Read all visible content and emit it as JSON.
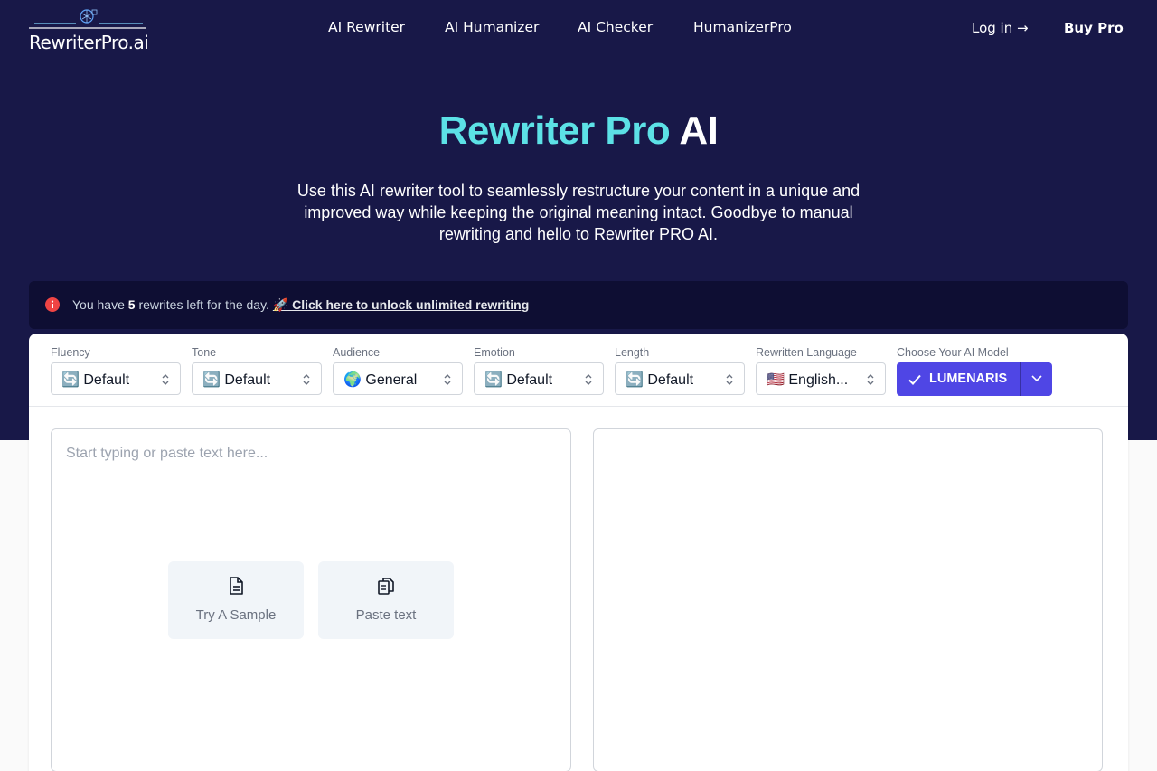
{
  "header": {
    "logo_text": "RewriterPro.ai",
    "nav": [
      "AI Rewriter",
      "AI Humanizer",
      "AI Checker",
      "HumanizerPro"
    ],
    "login_label": "Log in →",
    "buy_label": "Buy Pro"
  },
  "hero": {
    "title_part1": "Rewriter Pro",
    "title_part2": "AI",
    "subtitle": "Use this AI rewriter tool to seamlessly restructure your content in a unique and improved way while keeping the original meaning intact. Goodbye to manual rewriting and hello to Rewriter PRO AI."
  },
  "alert": {
    "text_before": "You have ",
    "count": "5",
    "text_after": " rewrites left for the day. ",
    "link_text": "🚀 Click here to unlock unlimited rewriting"
  },
  "options": [
    {
      "label": "Fluency",
      "value": "🔄 Default"
    },
    {
      "label": "Tone",
      "value": "🔄 Default"
    },
    {
      "label": "Audience",
      "value": "🌍 General"
    },
    {
      "label": "Emotion",
      "value": "🔄 Default"
    },
    {
      "label": "Length",
      "value": "🔄 Default"
    },
    {
      "label": "Rewritten Language",
      "value": "🇺🇸 English..."
    }
  ],
  "model": {
    "label": "Choose Your AI Model",
    "value": "LUMENARIS"
  },
  "editor": {
    "placeholder": "Start typing or paste text here...",
    "sample_label": "Try A Sample",
    "paste_label": "Paste text"
  },
  "colors": {
    "hero_bg": "#181848",
    "title_accent": "#5ce1e6",
    "model_button": "#4f46e5",
    "alert_icon": "#ef4444"
  }
}
